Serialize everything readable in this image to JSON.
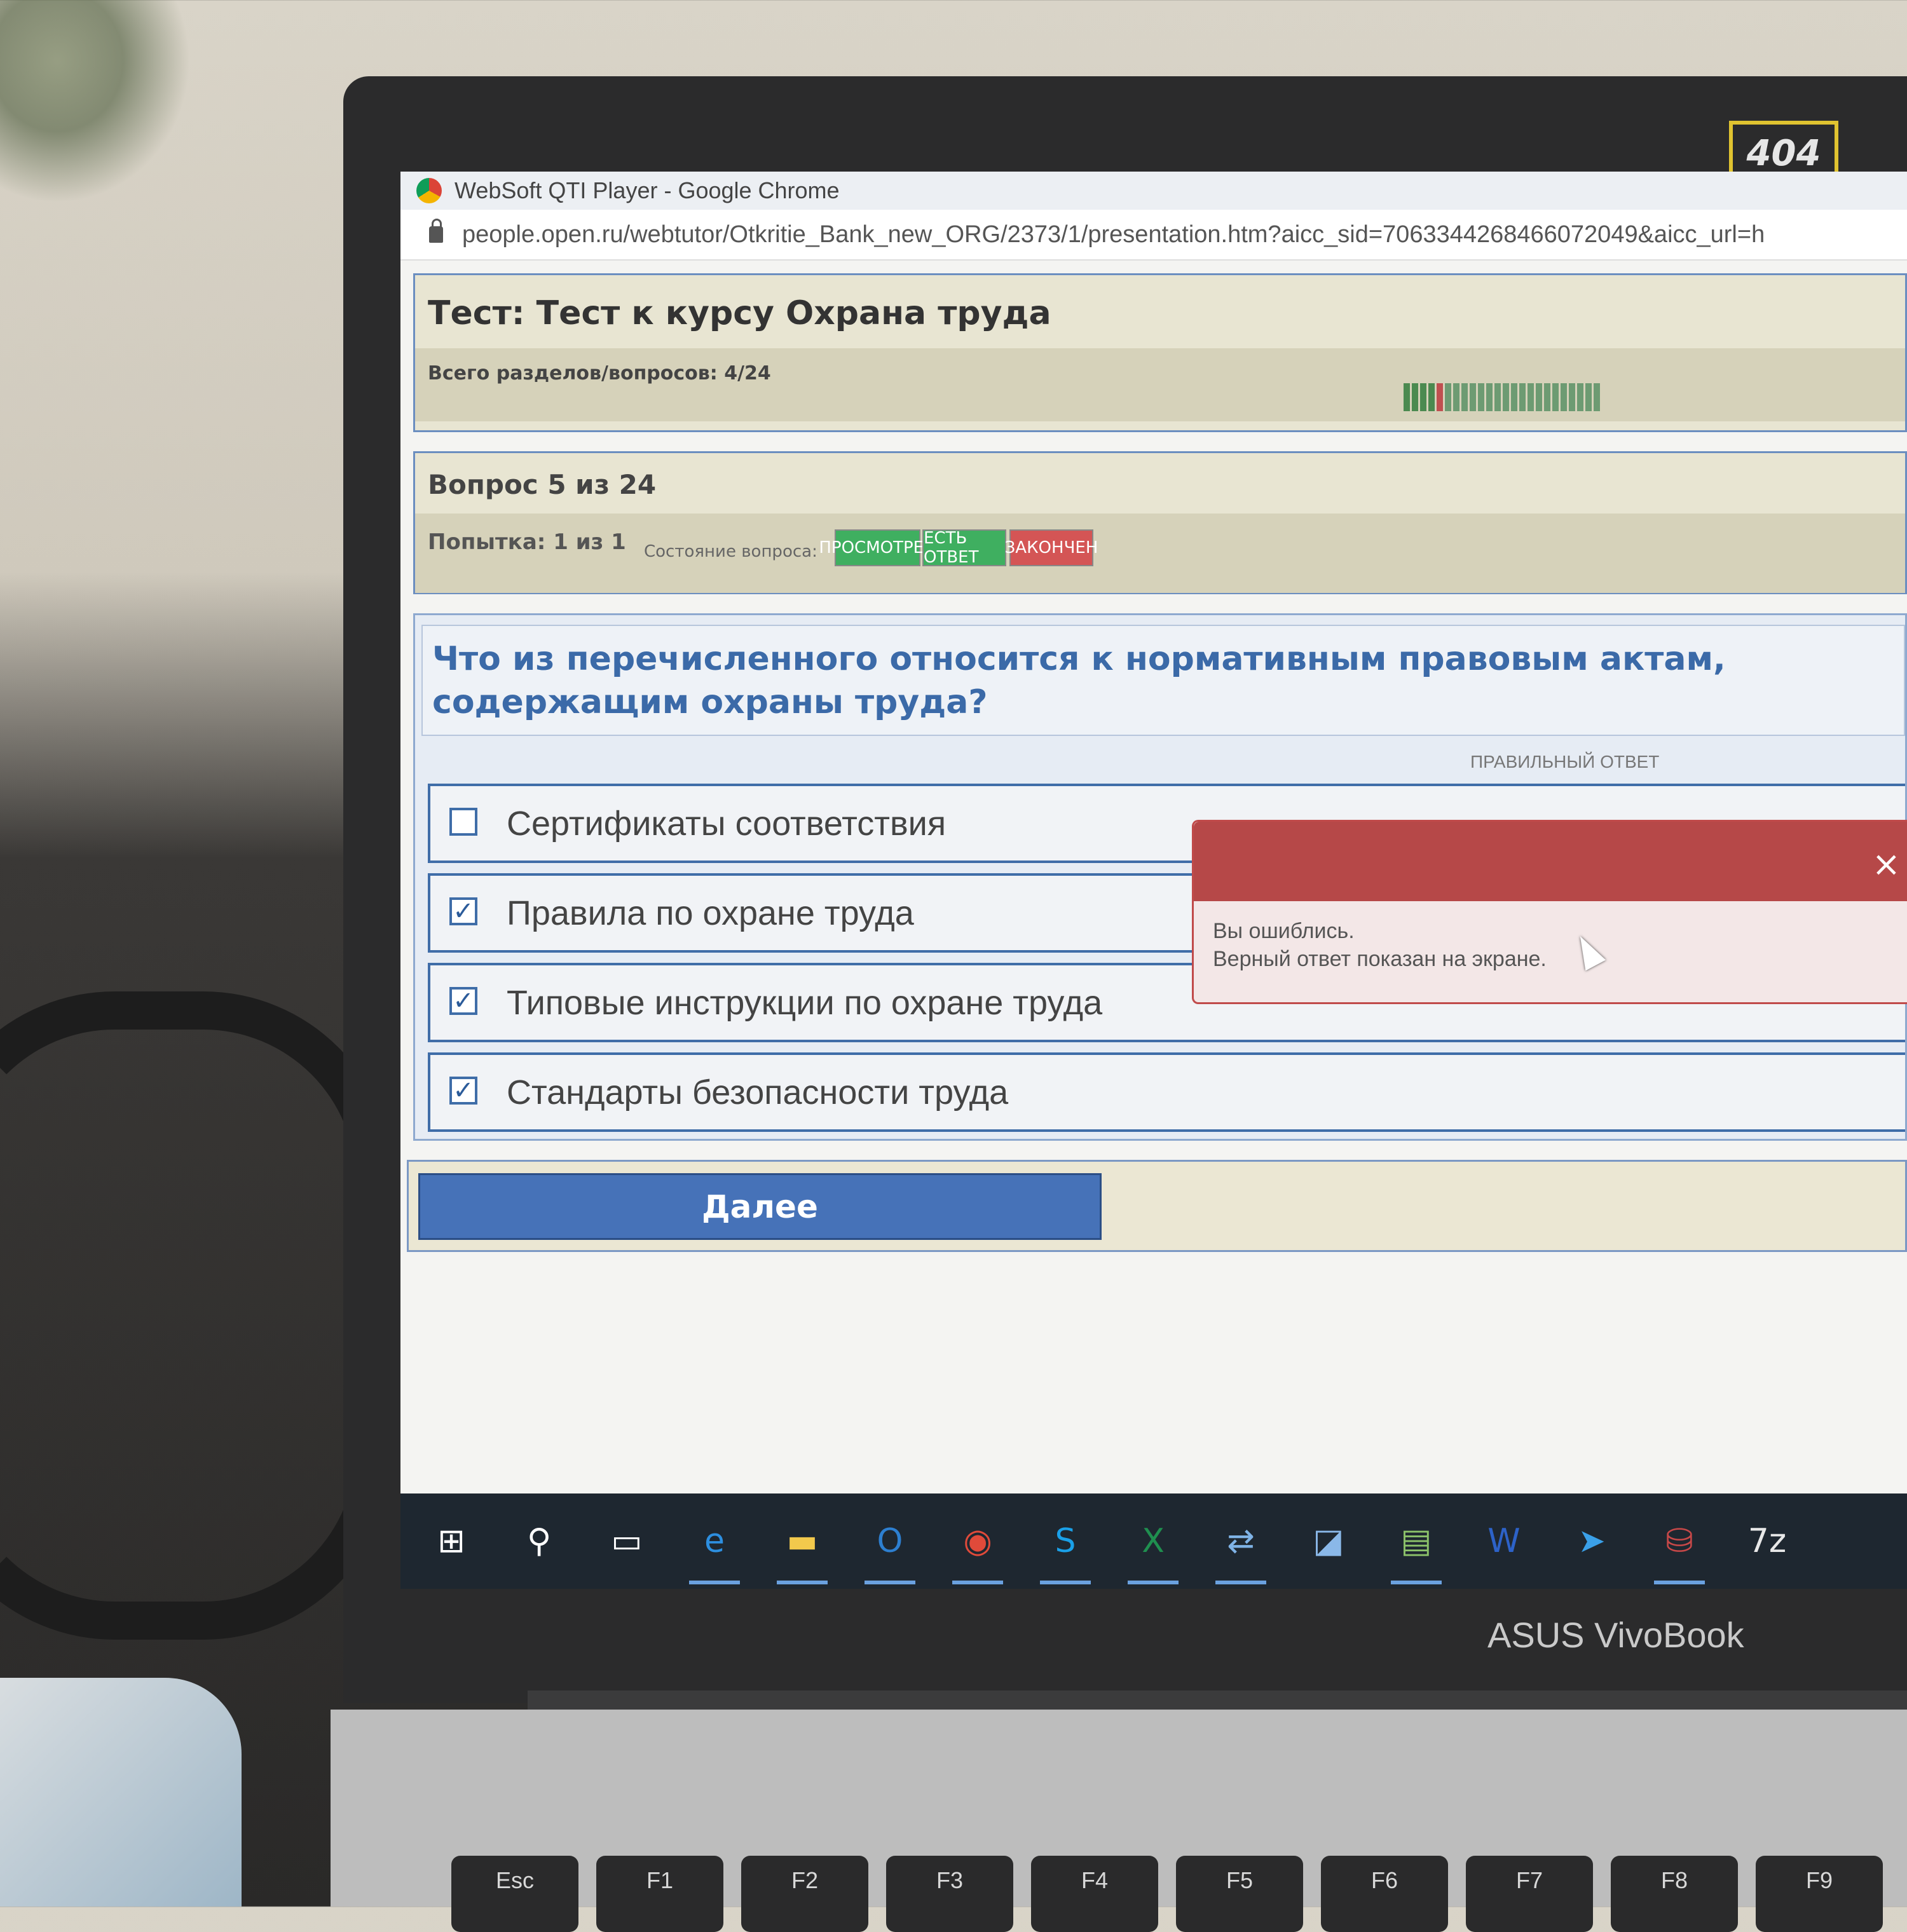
{
  "laptop": {
    "sticker": "404",
    "brand": "ASUS VivoBook",
    "keys": [
      "Esc",
      "F1",
      "F2",
      "F3",
      "F4",
      "F5",
      "F6",
      "F7",
      "F8",
      "F9"
    ]
  },
  "browser": {
    "window_title": "WebSoft QTI Player - Google Chrome",
    "url": "people.open.ru/webtutor/Otkritie_Bank_new_ORG/2373/1/presentation.htm?aicc_sid=7063344268466072049&aicc_url=h"
  },
  "test": {
    "title": "Тест: Тест к курсу Охрана труда",
    "sections_label": "Всего разделов/вопросов: 4/24",
    "progress_total": 24,
    "progress_done": 4,
    "progress_wrong_index": 4
  },
  "question": {
    "number_label": "Вопрос 5 из 24",
    "attempt_label": "Попытка: 1 из 1",
    "state_label": "Состояние вопроса:",
    "badges": [
      {
        "label": "ПРОСМОТРЕН",
        "color": "#3faf60"
      },
      {
        "label": "ЕСТЬ ОТВЕТ",
        "color": "#3faf60"
      },
      {
        "label": "ЗАКОНЧЕН",
        "color": "#d45555"
      }
    ],
    "text": "Что из перечисленного относится к нормативным правовым актам, содержащим охраны труда?",
    "correct_label": "ПРАВИЛЬНЫЙ ОТВЕТ",
    "answers": [
      {
        "label": "Сертификаты соответствия",
        "checked": false
      },
      {
        "label": "Правила по охране труда",
        "checked": true
      },
      {
        "label": "Типовые инструкции по охране труда",
        "checked": true
      },
      {
        "label": "Стандарты безопасности труда",
        "checked": true
      }
    ]
  },
  "popup": {
    "close": "×",
    "line1": "Вы ошиблись.",
    "line2": "Верный ответ показан на экране."
  },
  "next_button": "Далее",
  "taskbar": {
    "icons": [
      "windows-start-icon",
      "search-icon",
      "task-view-icon",
      "internet-explorer-icon",
      "file-explorer-icon",
      "outlook-icon",
      "chrome-icon",
      "skype-icon",
      "excel-icon",
      "network-icon",
      "notepad-icon",
      "image-editor-icon",
      "word-icon",
      "send-icon",
      "database-icon",
      "7zip-icon"
    ],
    "icon_glyphs": [
      "⊞",
      "⚲",
      "▭",
      "e",
      "▬",
      "O",
      "◉",
      "S",
      "X",
      "⇄",
      "◪",
      "▤",
      "W",
      "➤",
      "⛁",
      "7z"
    ],
    "icon_colors": [
      "#ffffff",
      "#ffffff",
      "#ffffff",
      "#2d8fe0",
      "#f2c94c",
      "#2d7fd0",
      "#e04a3a",
      "#1aa0e8",
      "#1f8f4f",
      "#7fb3e6",
      "#8ab8e8",
      "#8cc26a",
      "#2d62c8",
      "#3aa0e8",
      "#c84848",
      "#e8e8e8"
    ],
    "active": [
      false,
      false,
      false,
      true,
      true,
      true,
      true,
      true,
      true,
      true,
      false,
      true,
      false,
      false,
      true,
      false
    ]
  }
}
